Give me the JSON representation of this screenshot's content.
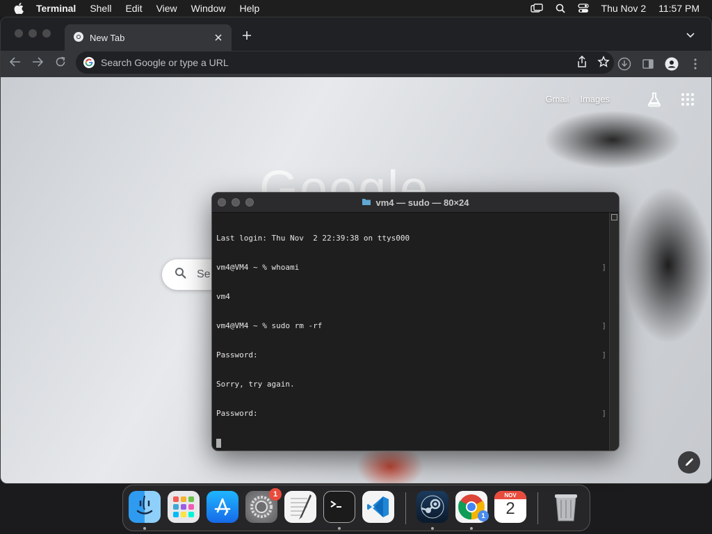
{
  "menubar": {
    "app_name": "Terminal",
    "items": [
      "Shell",
      "Edit",
      "View",
      "Window",
      "Help"
    ],
    "date": "Thu Nov 2",
    "time": "11:57 PM"
  },
  "chrome": {
    "tab_title": "New Tab",
    "omnibox_placeholder": "Search Google or type a URL",
    "ntp": {
      "logo_text": "Google",
      "gmail_label": "Gmail",
      "images_label": "Images",
      "search_placeholder": "Se"
    }
  },
  "terminal": {
    "title": "vm4 — sudo — 80×24",
    "lines": [
      "Last login: Thu Nov  2 22:39:38 on ttys000",
      "vm4@VM4 ~ % whoami",
      "vm4",
      "vm4@VM4 ~ % sudo rm -rf",
      "Password:",
      "Sorry, try again.",
      "Password:"
    ]
  },
  "dock": {
    "apps": [
      {
        "name": "Finder",
        "icon": "finder-icon"
      },
      {
        "name": "Launchpad",
        "icon": "launchpad-icon"
      },
      {
        "name": "App Store",
        "icon": "app-store-icon"
      },
      {
        "name": "System Settings",
        "icon": "settings-icon",
        "badge": "1"
      },
      {
        "name": "TextEdit",
        "icon": "textedit-icon"
      },
      {
        "name": "Terminal",
        "icon": "terminal-icon"
      },
      {
        "name": "Visual Studio Code",
        "icon": "vscode-icon"
      },
      {
        "name": "Steam",
        "icon": "steam-icon"
      },
      {
        "name": "Google Chrome",
        "icon": "chrome-icon",
        "badge": "1"
      },
      {
        "name": "Calendar",
        "icon": "calendar-icon",
        "month": "NOV",
        "day": "2"
      },
      {
        "name": "Trash",
        "icon": "trash-icon"
      }
    ]
  },
  "colors": {
    "menubar_bg": "#1e1e1e",
    "chrome_toolbar": "#35363a",
    "terminal_bg": "#1e1e1e",
    "badge_red": "#e94b3c"
  }
}
